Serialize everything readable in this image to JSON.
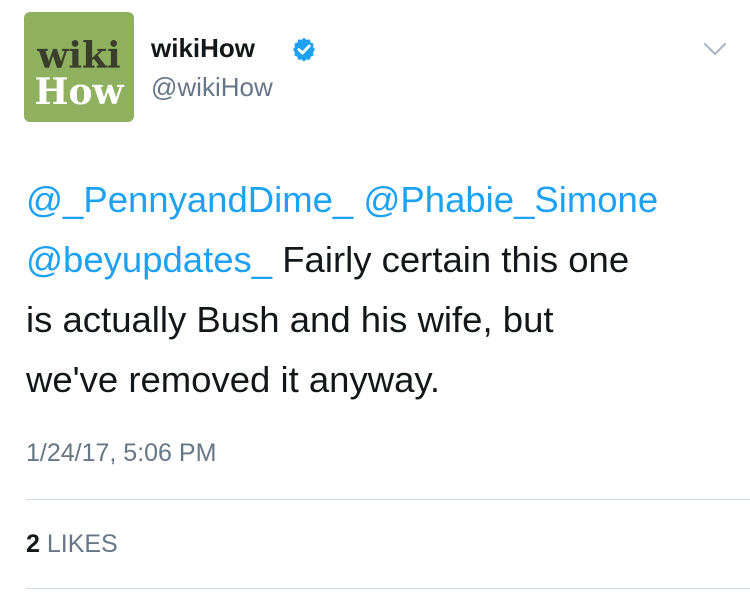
{
  "author": {
    "avatar_logo_line1": "wiki",
    "avatar_logo_line2": "How",
    "display_name": "wikiHow",
    "handle": "@wikiHow",
    "verified": true
  },
  "tweet": {
    "mention_1": "@_PennyandDime_",
    "mention_2": "@Phabie_Simone",
    "mention_3": "@beyupdates_",
    "text_line_2_rest": "Fairly certain this one",
    "text_line_3": "is actually Bush and his wife, but",
    "text_line_4": "we've removed it anyway."
  },
  "timestamp": "1/24/17, 5:06 PM",
  "stats": {
    "likes_count": "2",
    "likes_label": "LIKES"
  },
  "colors": {
    "link": "#1da1f2",
    "secondary_text": "#657786",
    "avatar_bg": "#8fb15f",
    "verified_badge": "#1da1f2"
  },
  "icons": {
    "verified": "verified-badge-icon",
    "menu": "chevron-down-icon"
  }
}
